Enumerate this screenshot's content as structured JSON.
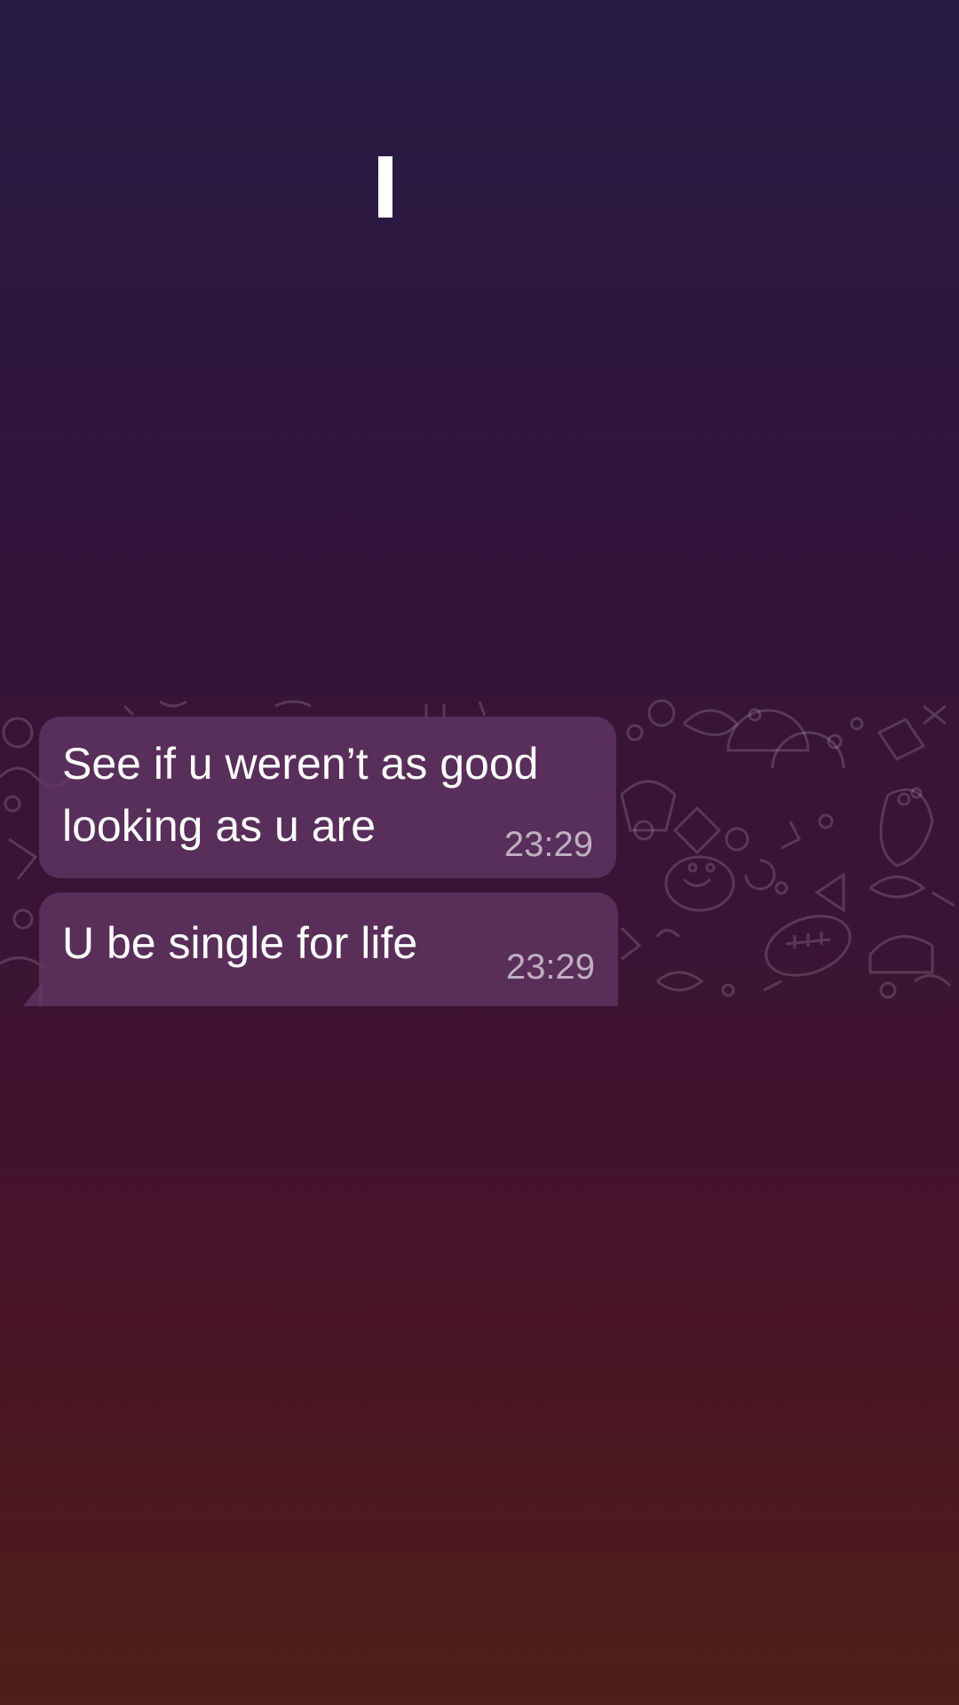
{
  "messages": [
    {
      "text": "See if u weren’t as good\nlooking as u are",
      "time": "23:29"
    },
    {
      "text": "U be single for life",
      "time": "23:29"
    }
  ]
}
